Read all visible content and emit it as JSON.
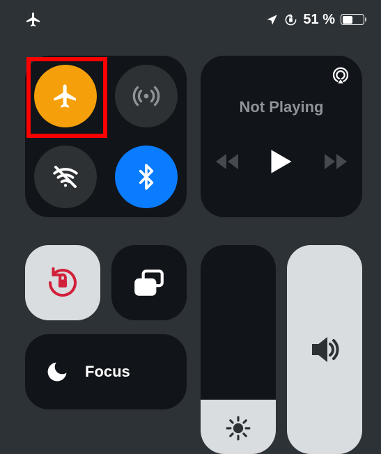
{
  "status": {
    "battery_percent_text": "51 %",
    "battery_fill_pct": 51
  },
  "media": {
    "title": "Not Playing"
  },
  "focus": {
    "label": "Focus"
  },
  "sliders": {
    "brightness_pct": 26,
    "volume_pct": 100
  },
  "connectivity": {
    "airplane_on": true,
    "cellular_on": false,
    "wifi_on": false,
    "bluetooth_on": true
  }
}
